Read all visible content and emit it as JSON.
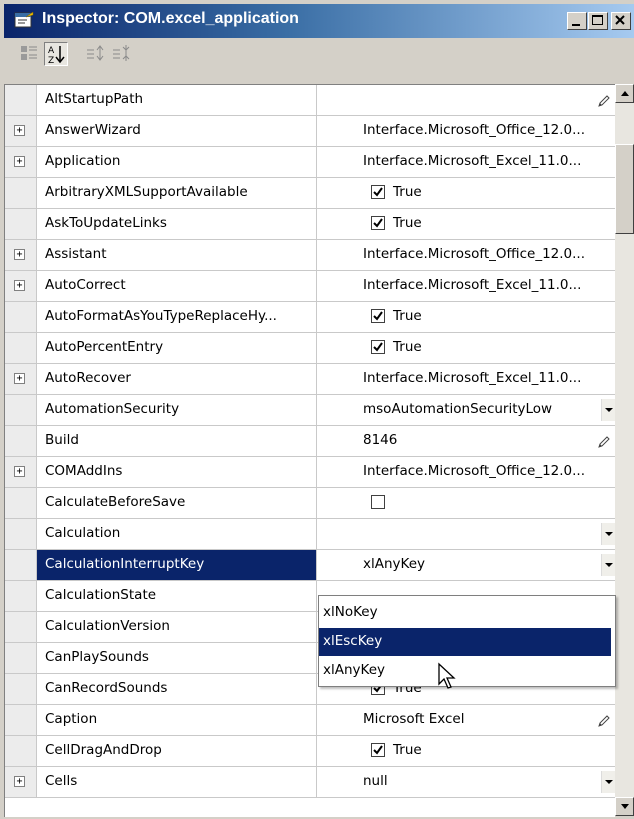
{
  "window": {
    "title": "Inspector: COM.excel_application",
    "icon": "inspector-icon"
  },
  "title_buttons": [
    "minimize-icon",
    "maximize-icon",
    "close-icon"
  ],
  "toolbar": {
    "tools": [
      "categorized-icon",
      "sort-alphabetically-icon",
      "expand-icon",
      "collapse-icon"
    ],
    "pressed": "sort-alphabetically-icon"
  },
  "rows": [
    {
      "name": "AltStartupPath",
      "value": "",
      "expand": false,
      "kind": "edit"
    },
    {
      "name": "AnswerWizard",
      "value": "Interface.Microsoft_Office_12.0...",
      "expand": true,
      "kind": "text"
    },
    {
      "name": "Application",
      "value": "Interface.Microsoft_Excel_11.0...",
      "expand": true,
      "kind": "text"
    },
    {
      "name": "ArbitraryXMLSupportAvailable",
      "value": "True",
      "expand": false,
      "kind": "check",
      "checked": true
    },
    {
      "name": "AskToUpdateLinks",
      "value": "True",
      "expand": false,
      "kind": "check",
      "checked": true
    },
    {
      "name": "Assistant",
      "value": "Interface.Microsoft_Office_12.0...",
      "expand": true,
      "kind": "text"
    },
    {
      "name": "AutoCorrect",
      "value": "Interface.Microsoft_Excel_11.0...",
      "expand": true,
      "kind": "text"
    },
    {
      "name": "AutoFormatAsYouTypeReplaceHy...",
      "value": "True",
      "expand": false,
      "kind": "check",
      "checked": true
    },
    {
      "name": "AutoPercentEntry",
      "value": "True",
      "expand": false,
      "kind": "check",
      "checked": true
    },
    {
      "name": "AutoRecover",
      "value": "Interface.Microsoft_Excel_11.0...",
      "expand": true,
      "kind": "text"
    },
    {
      "name": "AutomationSecurity",
      "value": "msoAutomationSecurityLow",
      "expand": false,
      "kind": "dropdown"
    },
    {
      "name": "Build",
      "value": "8146",
      "expand": false,
      "kind": "edit"
    },
    {
      "name": "COMAddIns",
      "value": "Interface.Microsoft_Office_12.0...",
      "expand": true,
      "kind": "text"
    },
    {
      "name": "CalculateBeforeSave",
      "value": "",
      "expand": false,
      "kind": "check",
      "checked": false
    },
    {
      "name": "Calculation",
      "value": "",
      "expand": false,
      "kind": "dropdown"
    },
    {
      "name": "CalculationInterruptKey",
      "value": "xlAnyKey",
      "expand": false,
      "kind": "dropdown",
      "selected": true
    },
    {
      "name": "CalculationState",
      "value": "",
      "expand": false,
      "kind": "text"
    },
    {
      "name": "CalculationVersion",
      "value": "",
      "expand": false,
      "kind": "text"
    },
    {
      "name": "CanPlaySounds",
      "value": "",
      "expand": false,
      "kind": "text"
    },
    {
      "name": "CanRecordSounds",
      "value": "True",
      "expand": false,
      "kind": "check",
      "checked": true
    },
    {
      "name": "Caption",
      "value": "Microsoft Excel",
      "expand": false,
      "kind": "edit"
    },
    {
      "name": "CellDragAndDrop",
      "value": "True",
      "expand": false,
      "kind": "check",
      "checked": true
    },
    {
      "name": "Cells",
      "value": "null",
      "expand": true,
      "kind": "dropdown"
    }
  ],
  "dropdown_popup": {
    "options": [
      "xlNoKey",
      "xlEscKey",
      "xlAnyKey"
    ],
    "highlighted": 1
  },
  "colors": {
    "selection": "#0a246a",
    "title_start": "#0a246a",
    "title_end": "#a6caf0"
  }
}
